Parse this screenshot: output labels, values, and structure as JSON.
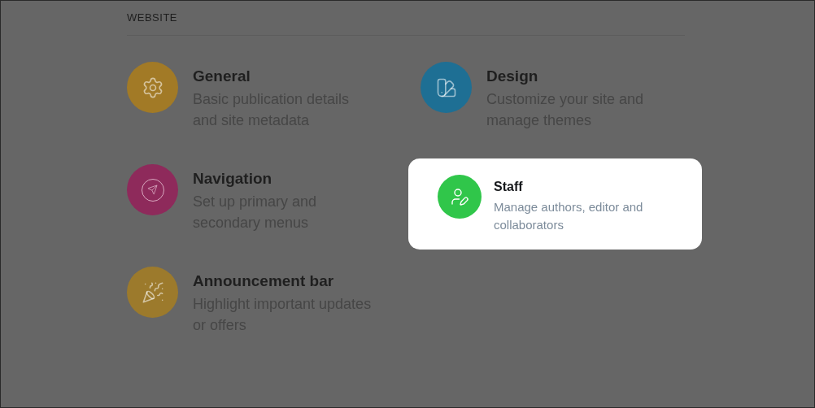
{
  "section": {
    "title": "WEBSITE"
  },
  "items": [
    {
      "title": "General",
      "description": "Basic publication details and site metadata",
      "color": "#a27a26",
      "highlighted": false
    },
    {
      "title": "Design",
      "description": "Customize your site and manage themes",
      "color": "#1e6f94",
      "highlighted": false
    },
    {
      "title": "Navigation",
      "description": "Set up primary and secondary menus",
      "color": "#8e2a5b",
      "highlighted": false
    },
    {
      "title": "Staff",
      "description": "Manage authors, editor and collaborators",
      "color": "#30c64a",
      "highlighted": true
    },
    {
      "title": "Announcement bar",
      "description": "Highlight important updates or offers",
      "color": "#9c7a2c",
      "highlighted": false
    }
  ]
}
